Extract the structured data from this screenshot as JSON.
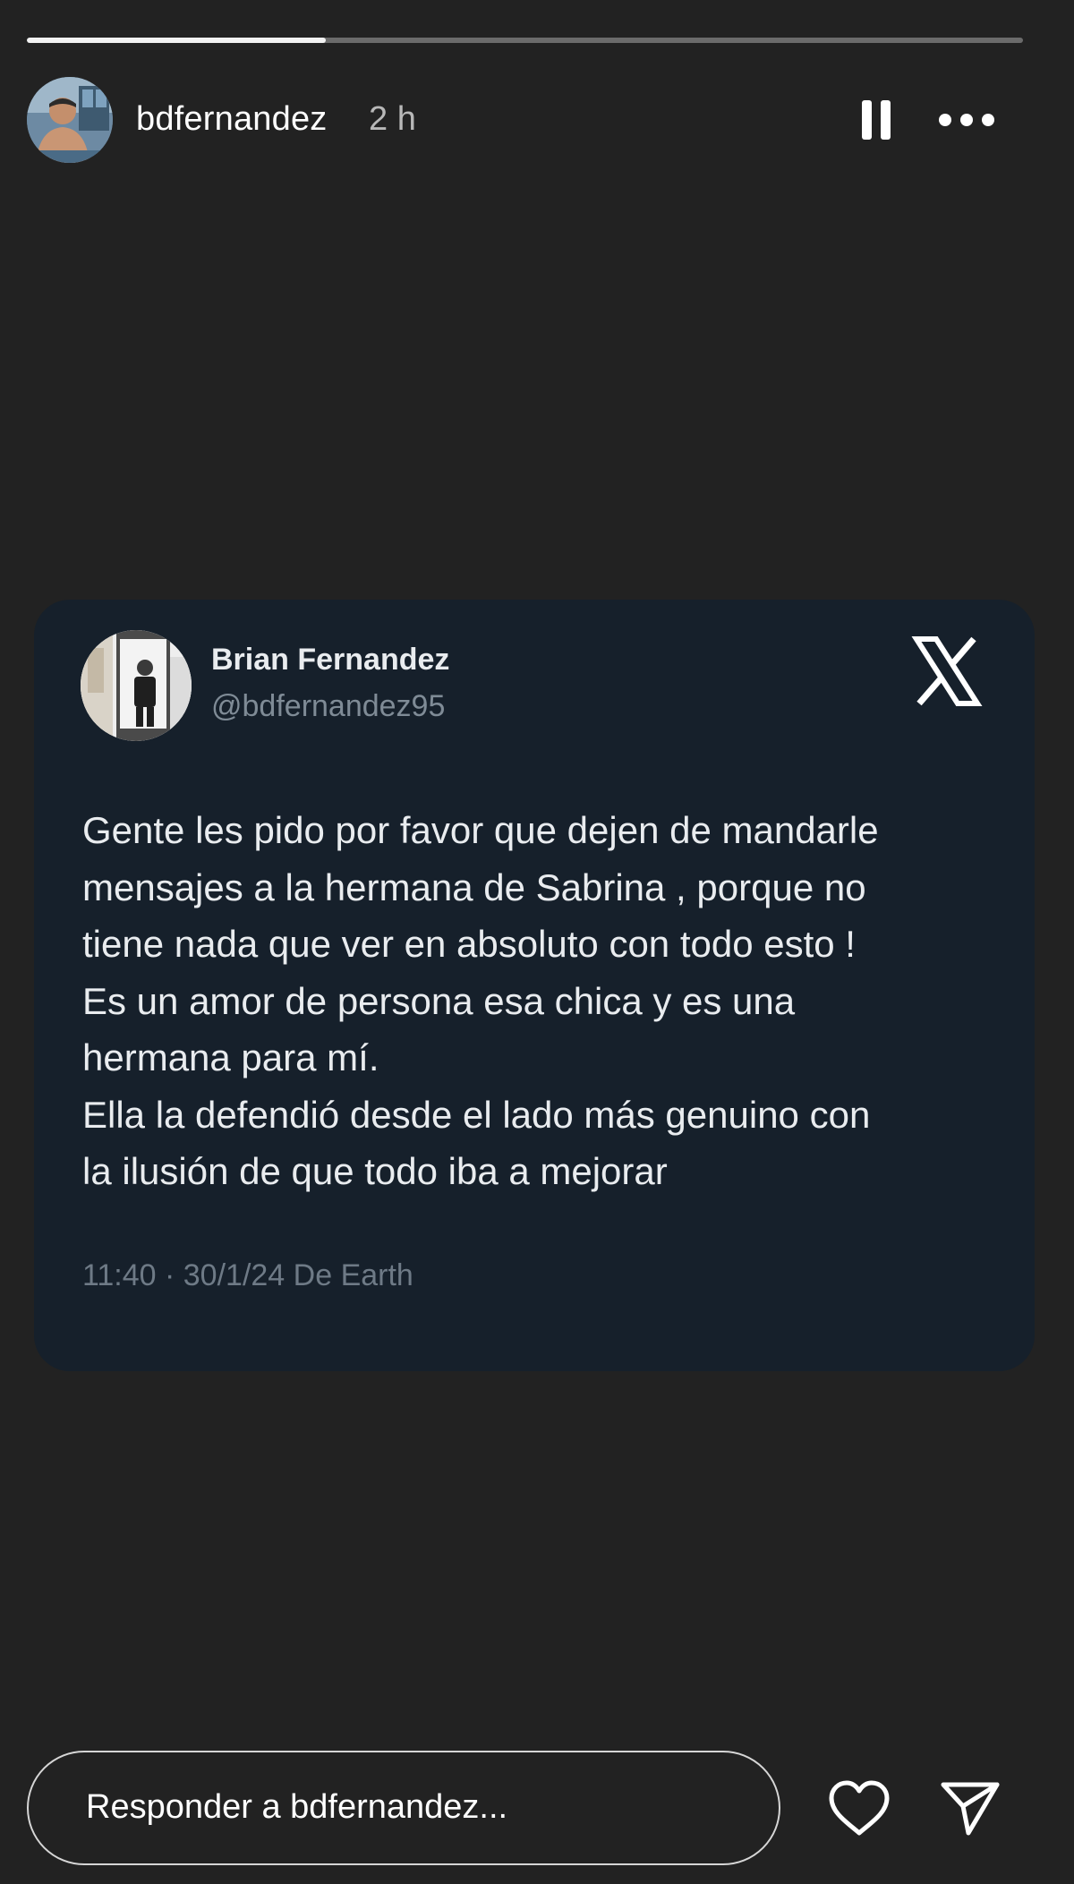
{
  "story": {
    "progress_fraction": 0.3
  },
  "header": {
    "username": "bdfernandez",
    "time_ago": "2 h",
    "pause_icon": "pause-icon",
    "more_icon": "more-horizontal-icon"
  },
  "tweet": {
    "display_name": "Brian Fernandez",
    "handle": "@bdfernandez95",
    "platform_icon": "x-logo-icon",
    "text_lines": [
      "Gente les pido por favor que dejen de mandarle",
      "mensajes a la hermana de Sabrina , porque no",
      "tiene nada que ver en absoluto con todo esto !",
      "Es un amor de persona esa chica y es una",
      "hermana para mí.",
      "Ella la defendió desde el lado más genuino con",
      "la ilusión de que todo iba a mejorar"
    ],
    "meta": "11:40 · 30/1/24 De Earth"
  },
  "footer": {
    "reply_placeholder": "Responder a bdfernandez...",
    "like_icon": "heart-icon",
    "share_icon": "send-icon"
  },
  "colors": {
    "background": "#222222",
    "tweet_card": "#16202b",
    "progress_track": "#6b6b6b",
    "progress_fill": "#f2f2f2"
  }
}
